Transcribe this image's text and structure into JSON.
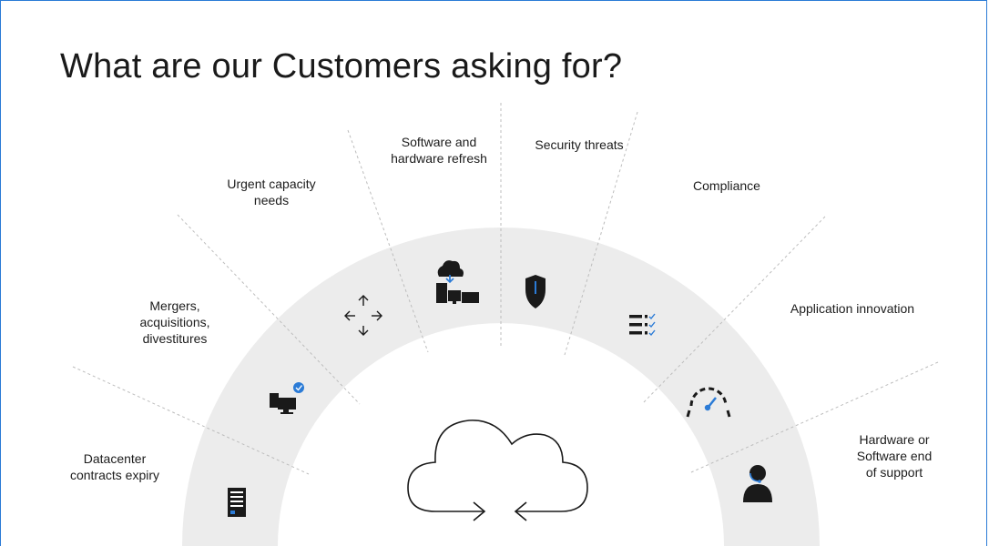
{
  "title": "What are our Customers asking for?",
  "items": [
    {
      "label": "Datacenter\ncontracts expiry",
      "icon": "document-icon"
    },
    {
      "label": "Mergers,\nacquisitions,\ndivestitures",
      "icon": "devices-check-icon"
    },
    {
      "label": "Urgent capacity\nneeds",
      "icon": "expand-arrows-icon"
    },
    {
      "label": "Software and\nhardware refresh",
      "icon": "cloud-devices-icon"
    },
    {
      "label": "Security threats",
      "icon": "shield-icon"
    },
    {
      "label": "Compliance",
      "icon": "checklist-icon"
    },
    {
      "label": "Application innovation",
      "icon": "gauge-icon"
    },
    {
      "label": "Hardware or\nSoftware end\nof support",
      "icon": "support-agent-icon"
    }
  ],
  "center_icon": "cloud-migration-icon",
  "colors": {
    "band": "#ececec",
    "icon": "#1a1a1a",
    "accent": "#2b7bd6",
    "border": "#2b7bd6"
  }
}
